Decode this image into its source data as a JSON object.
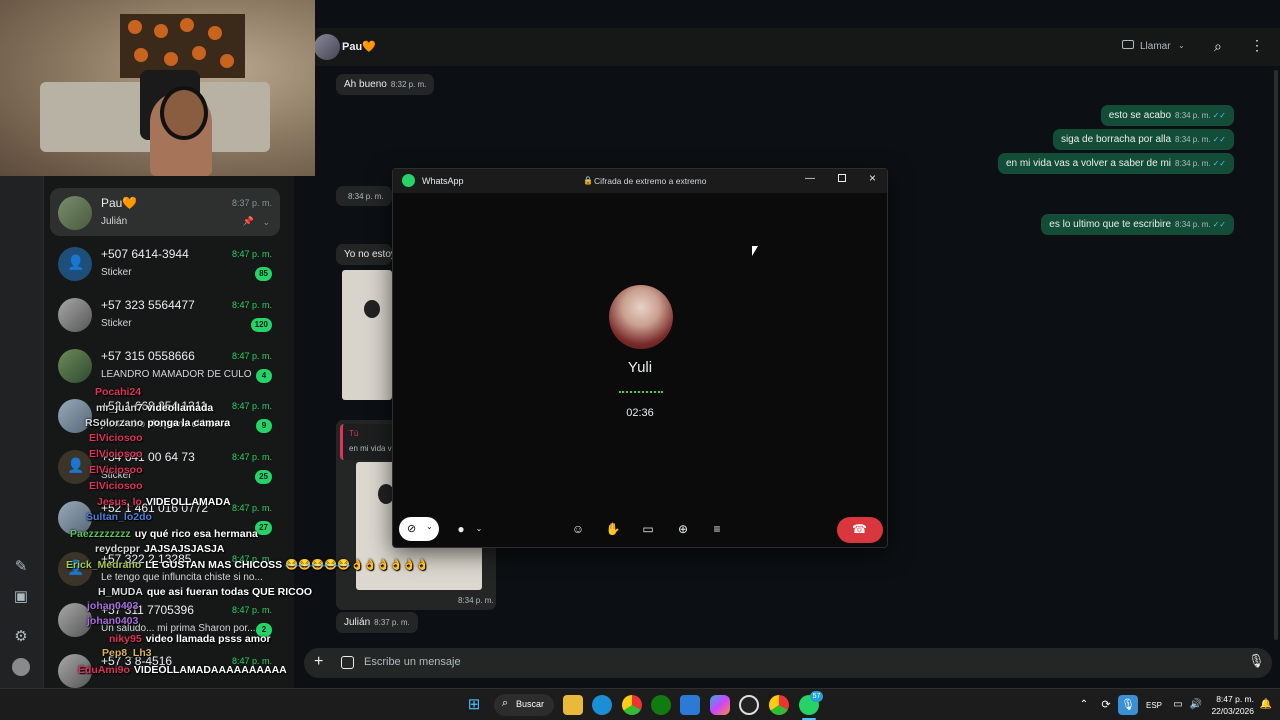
{
  "header": {
    "contact_name": "Pau🧡",
    "call_label": "Llamar"
  },
  "chat_list": [
    {
      "name": "Pau🧡",
      "time": "8:37 p. m.",
      "sub": "Julián",
      "time_color": "gray",
      "pinned": true
    },
    {
      "name": "+507 6414-3944",
      "time": "8:47 p. m.",
      "sub": "Sticker",
      "badge": "85"
    },
    {
      "name": "+57 323 5564477",
      "time": "8:47 p. m.",
      "sub": "Sticker",
      "badge": "120"
    },
    {
      "name": "+57 315 0558666",
      "time": "8:47 p. m.",
      "sub": "LEANDRO MAMADOR DE CULO",
      "badge": "4"
    },
    {
      "name": "+52 1 668 254 1311",
      "time": "8:47 p. m.",
      "sub": "jhon hairo chupeme el huevo",
      "badge": "9"
    },
    {
      "name": "+34 641 00 64 73",
      "time": "8:47 p. m.",
      "sub": "Sticker",
      "badge": "25"
    },
    {
      "name": "+52 1 461 016 0772",
      "time": "8:47 p. m.",
      "sub": "",
      "badge": "27"
    },
    {
      "name": "+57 322 2 13285",
      "time": "8:47 p. m.",
      "sub": "Le tengo que influncita chiste si no...",
      "badge": ""
    },
    {
      "name": "+57 311 7705396",
      "time": "8:47 p. m.",
      "sub": "Un saludo... mi prima Sharon por...",
      "badge": "2"
    },
    {
      "name": "+57 3 8-4516",
      "time": "8:47 p. m.",
      "sub": "",
      "badge": ""
    }
  ],
  "stream_chat": [
    {
      "user": "Pocahi24",
      "msg": "",
      "color": "#e0315a"
    },
    {
      "user": "mr_juan7",
      "msg": "videollamada",
      "color": "#d9d9d9"
    },
    {
      "user": "RSolorzano",
      "msg": "ponga la camara",
      "color": "#d9d9d9"
    },
    {
      "user": "ElViciosoo",
      "msg": "",
      "color": "#e0315a"
    },
    {
      "user": "ElViciosoo",
      "msg": "",
      "color": "#e0315a"
    },
    {
      "user": "ElViciosoo",
      "msg": "",
      "color": "#e0315a"
    },
    {
      "user": "ElViciosoo",
      "msg": "",
      "color": "#e0315a"
    },
    {
      "user": "Jesus_lo",
      "msg": "VIDEOLLAMADA",
      "color": "#e0315a"
    },
    {
      "user": "Sultan_lo2do",
      "msg": "",
      "color": "#4a7fd9"
    },
    {
      "user": "Paezzzzzzzz",
      "msg": "uy qué rico esa hermana",
      "color": "#5cc25c"
    },
    {
      "user": "reydcppr",
      "msg": "JAJSAJSJASJA",
      "color": "#d9d9d9"
    },
    {
      "user": "Erick_Medrano",
      "msg": "LE GUSTAN MAS CHICOSS 😂😂😂😂😂👌👌👌👌👌👌",
      "color": "#a8c94a"
    },
    {
      "user": "H_MUDA",
      "msg": "que asi fueran todas QUE RICOO",
      "color": "#d9d9d9"
    },
    {
      "user": "johan0403",
      "msg": "",
      "color": "#a86ce0"
    },
    {
      "user": "johan0403",
      "msg": "",
      "color": "#a86ce0"
    },
    {
      "user": "niky95",
      "msg": "video llamada psss amor",
      "color": "#e0315a"
    },
    {
      "user": "Pep8_Lh3",
      "msg": "",
      "color": "#d9b45a"
    },
    {
      "user": "EduAmi9o",
      "msg": "VIDEOLLAMADAAAAAAAAAA",
      "color": "#e0315a"
    }
  ],
  "messages_in": [
    {
      "text": "Ah bueno",
      "time": "8:32 p. m."
    },
    {
      "text": "",
      "time": "8:34 p. m."
    },
    {
      "text": "Yo no estoy",
      "time": ""
    },
    {
      "text": "",
      "time": "8:34 p. m."
    },
    {
      "text": "Julián",
      "time": "8:37 p. m."
    }
  ],
  "reply_quote": {
    "author": "Tú",
    "text": "en mi vida v"
  },
  "messages_out": [
    {
      "text": "esto se acabo",
      "time": "8:34 p. m."
    },
    {
      "text": "siga de borracha por alla",
      "time": "8:34 p. m."
    },
    {
      "text": "en mi vida vas a volver a saber de mi",
      "time": "8:34 p. m."
    },
    {
      "text": "es lo ultimo que te escribire",
      "time": "8:34 p. m."
    }
  ],
  "call": {
    "app_title": "WhatsApp",
    "encryption": "Cifrada de extremo a extremo",
    "contact": "Yuli",
    "duration": "02:36"
  },
  "composer": {
    "placeholder": "Escribe un mensaje"
  },
  "taskbar": {
    "search_label": "Buscar",
    "whatsapp_badge": "57",
    "lang": "ESP",
    "time": "8:47 p. m.",
    "date": "22/03/2026"
  },
  "colors": {
    "accent_green": "#25d366",
    "bubble_out": "#144d37",
    "bubble_in": "#242626",
    "end_call_red": "#d9363e"
  },
  "icons": [
    "video-call-icon",
    "search-icon",
    "menu-dots-icon",
    "lock-icon",
    "minimize-icon",
    "maximize-icon",
    "close-icon",
    "camera-off-icon",
    "mic-icon",
    "emoji-icon",
    "raise-hand-icon",
    "screen-share-icon",
    "add-person-icon",
    "captions-icon",
    "end-call-icon",
    "plus-icon",
    "sticker-icon",
    "voice-mic-icon"
  ]
}
